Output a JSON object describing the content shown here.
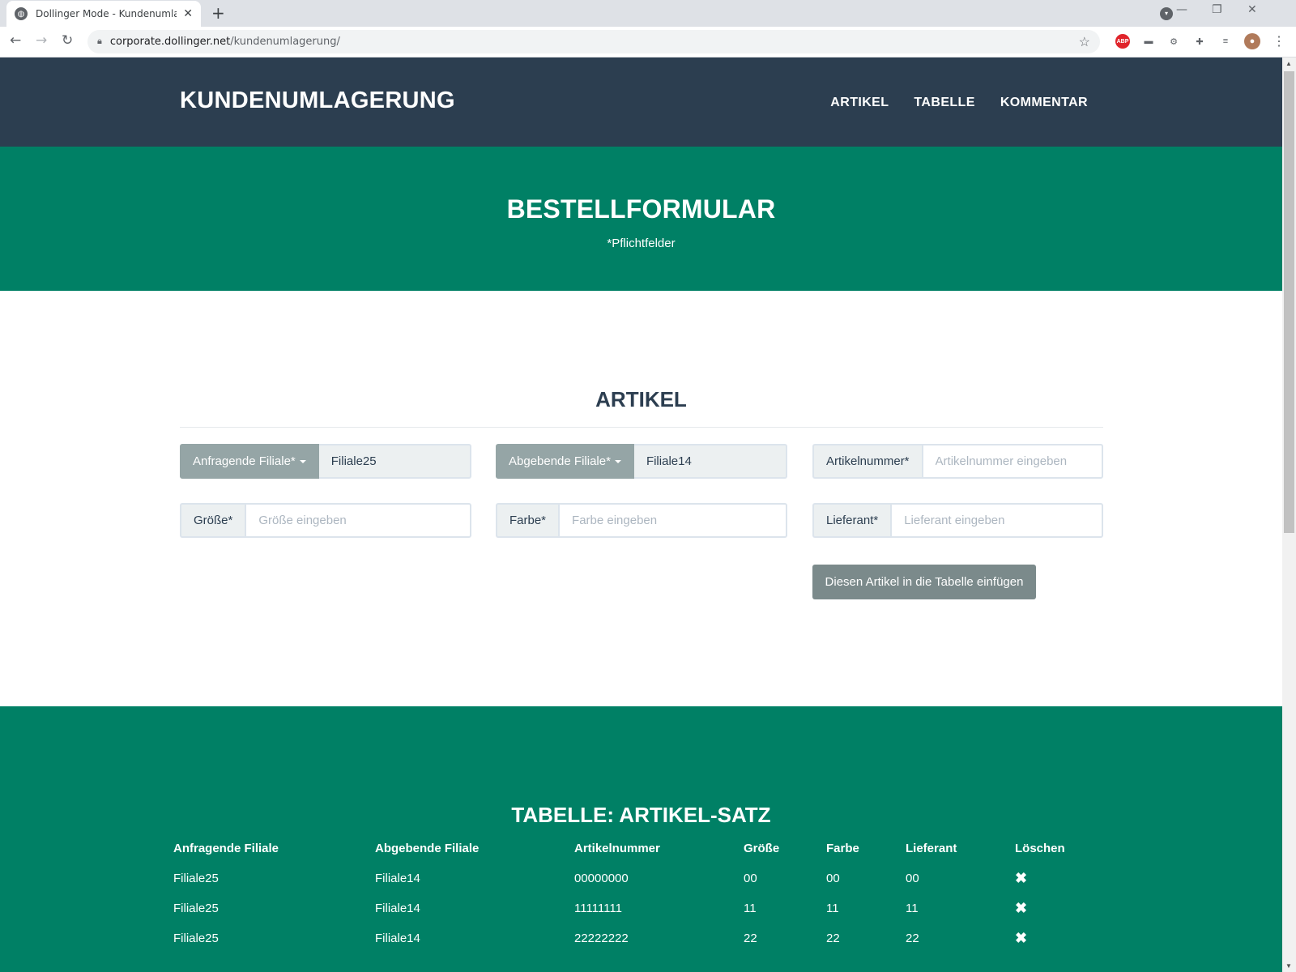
{
  "browser": {
    "tab_title": "Dollinger Mode - Kundenumlage",
    "url_domain": "corporate.dollinger.net",
    "url_path": "/kundenumlagerung/"
  },
  "navbar": {
    "brand": "KUNDENUMLAGERUNG",
    "links": [
      "ARTIKEL",
      "TABELLE",
      "KOMMENTAR"
    ]
  },
  "hero": {
    "title": "BESTELLFORMULAR",
    "subtitle": "*Pflichtfelder"
  },
  "form": {
    "heading": "ARTIKEL",
    "anfragende": {
      "label": "Anfragende Filiale*",
      "value": "Filiale25"
    },
    "abgebende": {
      "label": "Abgebende Filiale*",
      "value": "Filiale14"
    },
    "artikelnummer": {
      "label": "Artikelnummer*",
      "placeholder": "Artikelnummer eingeben"
    },
    "groesse": {
      "label": "Größe*",
      "placeholder": "Größe eingeben"
    },
    "farbe": {
      "label": "Farbe*",
      "placeholder": "Farbe eingeben"
    },
    "lieferant": {
      "label": "Lieferant*",
      "placeholder": "Lieferant eingeben"
    },
    "add_button": "Diesen Artikel in die Tabelle einfügen"
  },
  "table": {
    "heading": "TABELLE: ARTIKEL-SATZ",
    "columns": [
      "Anfragende Filiale",
      "Abgebende Filiale",
      "Artikelnummer",
      "Größe",
      "Farbe",
      "Lieferant",
      "Löschen"
    ],
    "rows": [
      [
        "Filiale25",
        "Filiale14",
        "00000000",
        "00",
        "00",
        "00"
      ],
      [
        "Filiale25",
        "Filiale14",
        "11111111",
        "11",
        "11",
        "11"
      ],
      [
        "Filiale25",
        "Filiale14",
        "22222222",
        "22",
        "22",
        "22"
      ]
    ],
    "delete_icon": "✖"
  },
  "colors": {
    "navbar": "#2c3e50",
    "green": "#008065",
    "dropdown_addon": "#95a5a6",
    "button": "#7b8a8b"
  }
}
